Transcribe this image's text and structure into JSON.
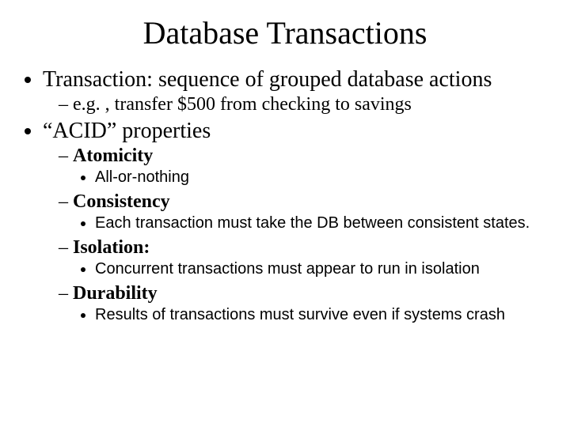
{
  "title": "Database Transactions",
  "bullets": {
    "b1": "Transaction: sequence of grouped database actions",
    "b1_1": "e.g. , transfer $500 from checking to savings",
    "b2": "“ACID” properties",
    "b2_1": "Atomicity",
    "b2_1_1": "All-or-nothing",
    "b2_2": "Consistency",
    "b2_2_1": "Each transaction must take the DB between consistent states.",
    "b2_3": "Isolation:",
    "b2_3_1": "Concurrent transactions must appear to run in isolation",
    "b2_4": "Durability",
    "b2_4_1": "Results of transactions must survive even if systems crash"
  }
}
